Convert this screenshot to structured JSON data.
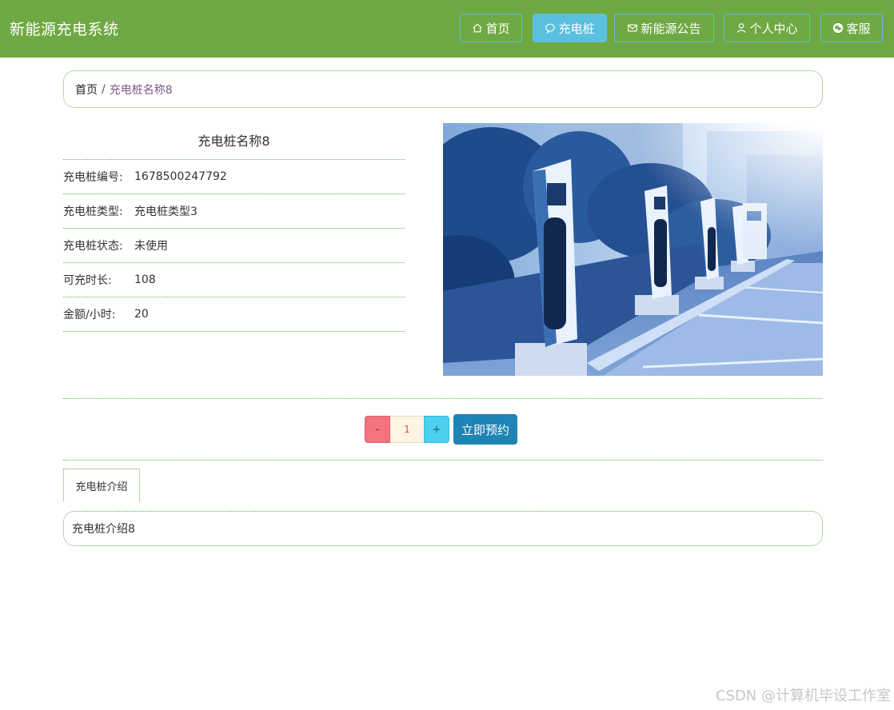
{
  "header": {
    "brand": "新能源充电系统",
    "nav": [
      {
        "label": "首页",
        "icon": "home-icon"
      },
      {
        "label": "充电桩",
        "icon": "chat-icon",
        "active": true
      },
      {
        "label": "新能源公告",
        "icon": "mail-icon"
      },
      {
        "label": "个人中心",
        "icon": "user-icon"
      },
      {
        "label": "客服",
        "icon": "wechat-icon"
      }
    ],
    "bg_color": "#6fa943",
    "accent_color": "#5bc0de"
  },
  "breadcrumb": {
    "home": "首页",
    "separator": "/",
    "current": "充电桩名称8"
  },
  "details": {
    "title": "充电桩名称8",
    "rows": [
      {
        "label": "充电桩编号:",
        "value": "1678500247792"
      },
      {
        "label": "充电桩类型:",
        "value": "充电桩类型3"
      },
      {
        "label": "充电桩状态:",
        "value": "未使用"
      },
      {
        "label": "可充时长:",
        "value": "108"
      },
      {
        "label": "金额/小时:",
        "value": "20"
      }
    ]
  },
  "order": {
    "minus": "-",
    "quantity": "1",
    "plus": "+",
    "reserve": "立即预约"
  },
  "tabs": [
    {
      "label": "充电桩介绍",
      "active": true
    }
  ],
  "tab_content": "充电桩介绍8",
  "watermark": "CSDN @计算机毕设工作室"
}
